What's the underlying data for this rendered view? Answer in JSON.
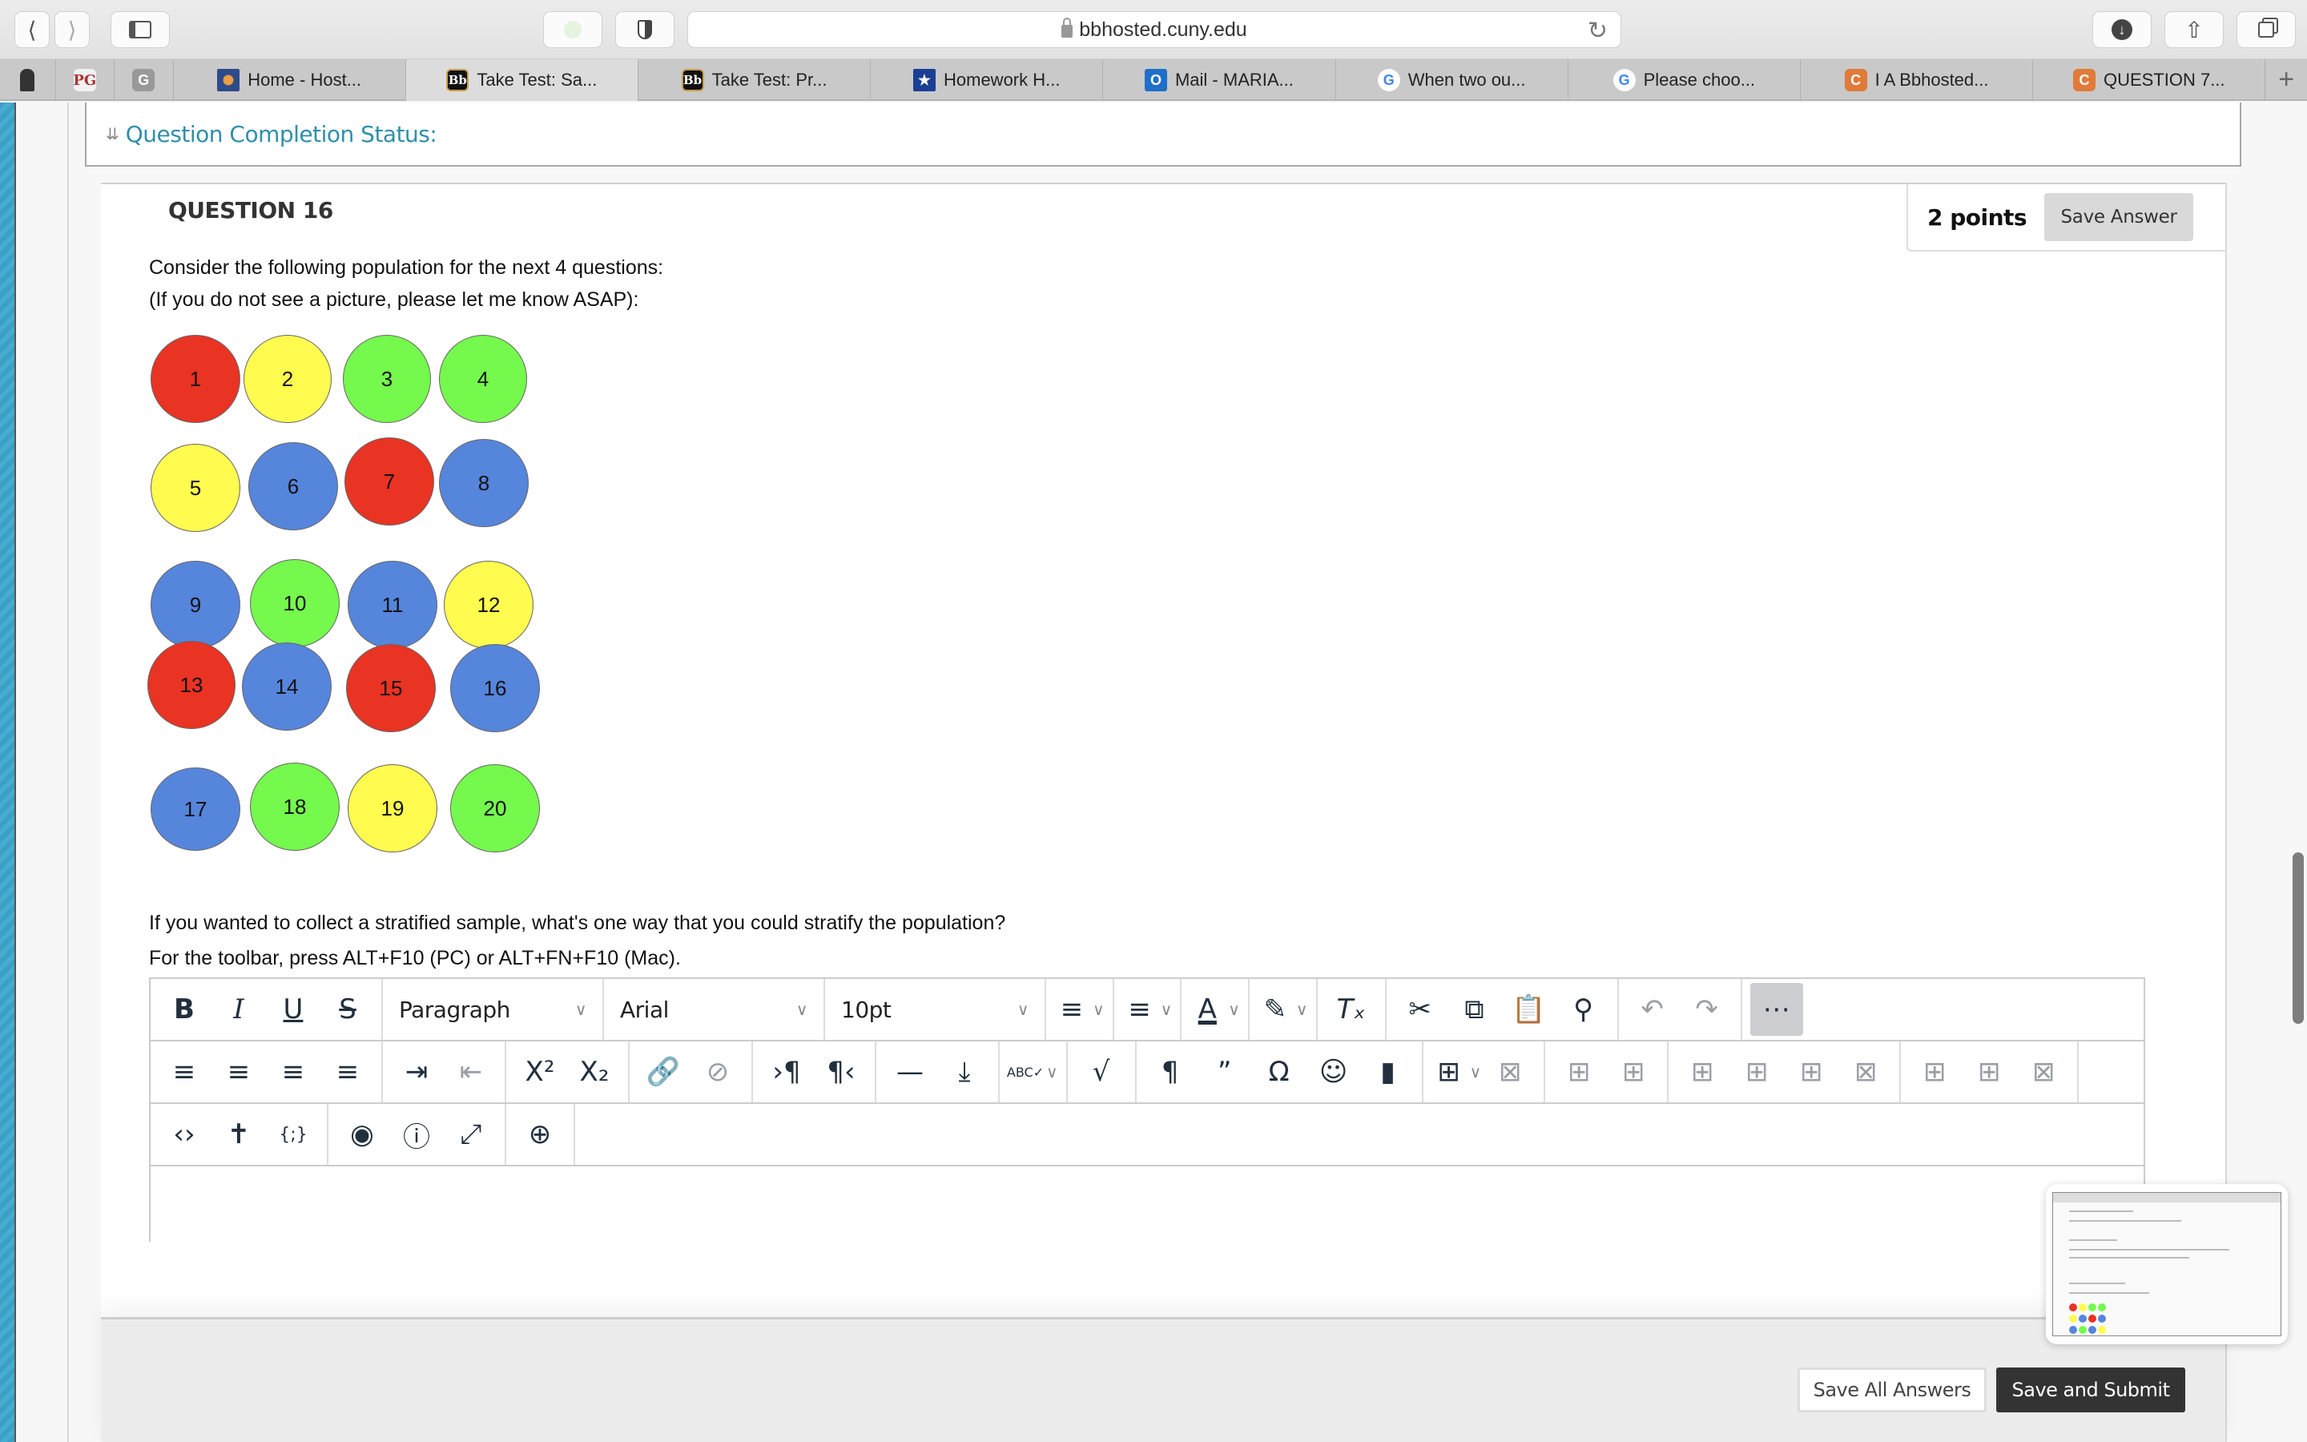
{
  "browser": {
    "url": "bbhosted.cuny.edu",
    "pinned_tabs": [
      {
        "icon": "graduate-avatar-icon"
      },
      {
        "icon": "pg-logo-icon",
        "text": "PG"
      },
      {
        "icon": "g-logo-icon",
        "text": "G"
      }
    ],
    "tabs": [
      {
        "label": "Home - Host...",
        "icon": "hostos-logo-icon",
        "active": false
      },
      {
        "label": "Take Test: Sa...",
        "icon": "blackboard-icon",
        "icon_text": "Bb",
        "active": true
      },
      {
        "label": "Take Test: Pr...",
        "icon": "blackboard-icon",
        "icon_text": "Bb",
        "active": false
      },
      {
        "label": "Homework H...",
        "icon": "star-bookmark-icon",
        "active": false
      },
      {
        "label": "Mail - MARIA...",
        "icon": "outlook-icon",
        "icon_text": "O",
        "active": false
      },
      {
        "label": "When two ou...",
        "icon": "google-icon",
        "icon_text": "G",
        "active": false
      },
      {
        "label": "Please choo...",
        "icon": "google-icon",
        "icon_text": "G",
        "active": false
      },
      {
        "label": "I A Bbhosted...",
        "icon": "chegg-icon",
        "icon_text": "C",
        "active": false
      },
      {
        "label": "QUESTION 7...",
        "icon": "chegg-icon",
        "icon_text": "C",
        "active": false
      }
    ],
    "new_tab": "+"
  },
  "status": {
    "label": "Question Completion Status:"
  },
  "question": {
    "title": "QUESTION 16",
    "points": "2 points",
    "save_answer": "Save Answer",
    "intro_line1": "Consider the following population for the next 4 questions:",
    "intro_line2": "(If you do not see a picture, please let me know ASAP):",
    "prompt": "If you wanted to collect a stratified sample, what's one way that you could stratify the population?",
    "toolbar_hint": "For the toolbar, press ALT+F10 (PC) or ALT+FN+F10 (Mac).",
    "colors": {
      "red": "#e93323",
      "yellow": "#fffb4f",
      "green": "#75f94d",
      "blue": "#5685dc"
    },
    "population": [
      {
        "n": "1",
        "color": "red"
      },
      {
        "n": "2",
        "color": "yellow"
      },
      {
        "n": "3",
        "color": "green"
      },
      {
        "n": "4",
        "color": "green"
      },
      {
        "n": "5",
        "color": "yellow"
      },
      {
        "n": "6",
        "color": "blue"
      },
      {
        "n": "7",
        "color": "red"
      },
      {
        "n": "8",
        "color": "blue"
      },
      {
        "n": "9",
        "color": "blue"
      },
      {
        "n": "10",
        "color": "green"
      },
      {
        "n": "11",
        "color": "blue"
      },
      {
        "n": "12",
        "color": "yellow"
      },
      {
        "n": "13",
        "color": "red"
      },
      {
        "n": "14",
        "color": "blue"
      },
      {
        "n": "15",
        "color": "red"
      },
      {
        "n": "16",
        "color": "blue"
      },
      {
        "n": "17",
        "color": "blue"
      },
      {
        "n": "18",
        "color": "green"
      },
      {
        "n": "19",
        "color": "yellow"
      },
      {
        "n": "20",
        "color": "green"
      }
    ]
  },
  "editor": {
    "block_format": "Paragraph",
    "font_family": "Arial",
    "font_size": "10pt",
    "answer_text": ""
  },
  "footer": {
    "save_all": "Save All Answers",
    "save_submit": "Save and Submit"
  }
}
